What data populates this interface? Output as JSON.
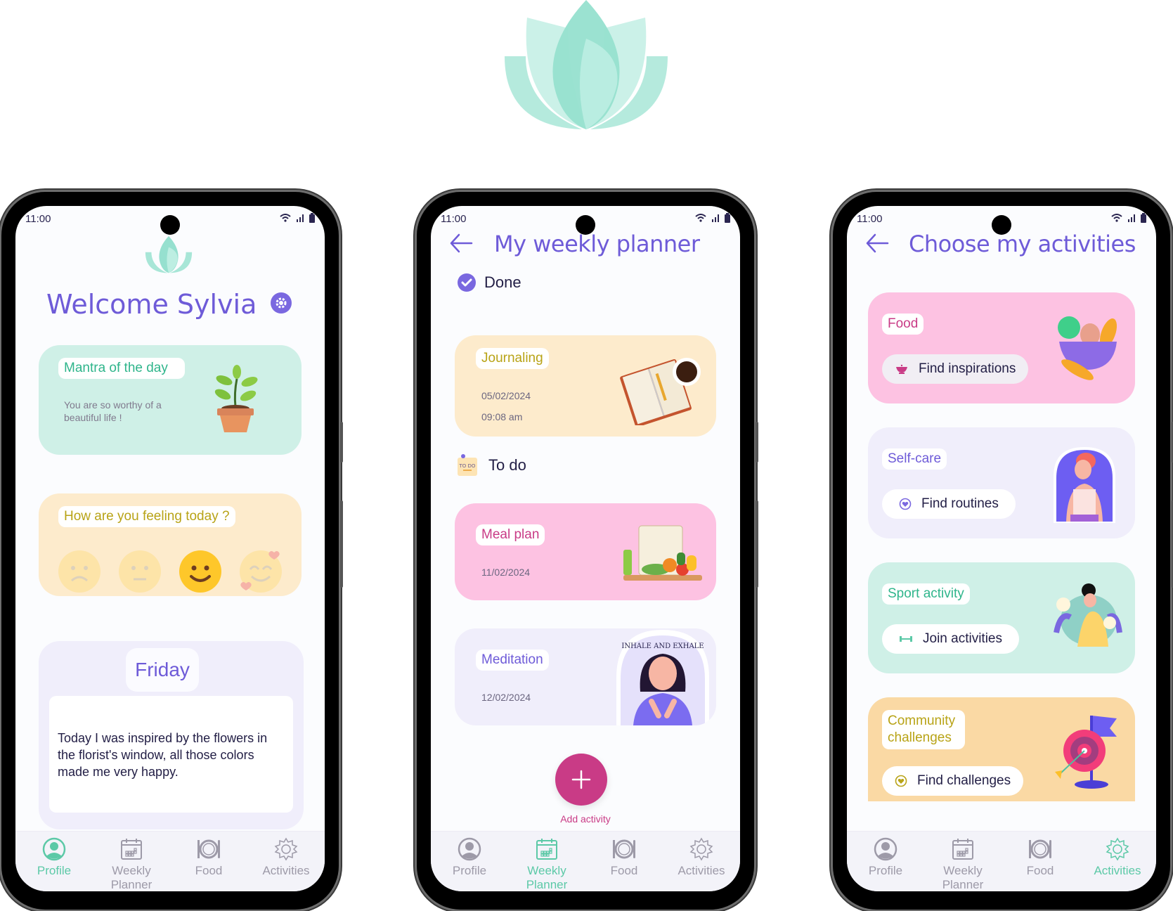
{
  "colors": {
    "primary_purple": "#6e5bd8",
    "mint": "#5cc9a7",
    "pink_accent": "#c93b86",
    "gold_text": "#b8a316",
    "card_mint": "#cff0e7",
    "card_cream": "#fdebcc",
    "card_lavender": "#f0eefb",
    "card_pink": "#fdc2e2",
    "card_orange": "#fad9a4",
    "nav_inactive": "#9d9aa8"
  },
  "status_bar": {
    "time": "11:00"
  },
  "nav_items": [
    {
      "label": "Profile",
      "icon": "profile-icon"
    },
    {
      "label": "Weekly Planner",
      "icon": "calendar-icon"
    },
    {
      "label": "Food",
      "icon": "plate-icon"
    },
    {
      "label": "Activities",
      "icon": "gear-icon"
    }
  ],
  "profile_screen": {
    "title": "Welcome Sylvia",
    "mantra": {
      "label": "Mantra of the day",
      "text": "You are so worthy of a beautiful life !"
    },
    "feeling": {
      "label": "How are you feeling today ?",
      "options": [
        "sad",
        "neutral",
        "happy",
        "loved"
      ],
      "selected": "happy"
    },
    "journal": {
      "day": "Friday",
      "text": "Today I was inspired by the flowers in the florist's window, all those colors made me very happy."
    },
    "active_nav": "Profile"
  },
  "planner_screen": {
    "title": "My weekly planner",
    "done_label": "Done",
    "todo_label": "To do",
    "done_items": [
      {
        "title": "Journaling",
        "date": "05/02/2024",
        "time": "09:08 am"
      }
    ],
    "todo_items": [
      {
        "title": "Meal plan",
        "date": "11/02/2024"
      },
      {
        "title": "Meditation",
        "date": "12/02/2024",
        "image_text": "INHALE AND EXHALE"
      }
    ],
    "add_label": "Add activity",
    "todo_badge": "TO DO",
    "active_nav": "Weekly Planner"
  },
  "activities_screen": {
    "title": "Choose my activities",
    "categories": [
      {
        "label": "Food",
        "action": "Find inspirations"
      },
      {
        "label": "Self-care",
        "action": "Find routines"
      },
      {
        "label": "Sport activity",
        "action": "Join activities"
      },
      {
        "label": "Community challenges",
        "action": "Find challenges"
      }
    ],
    "active_nav": "Activities"
  }
}
